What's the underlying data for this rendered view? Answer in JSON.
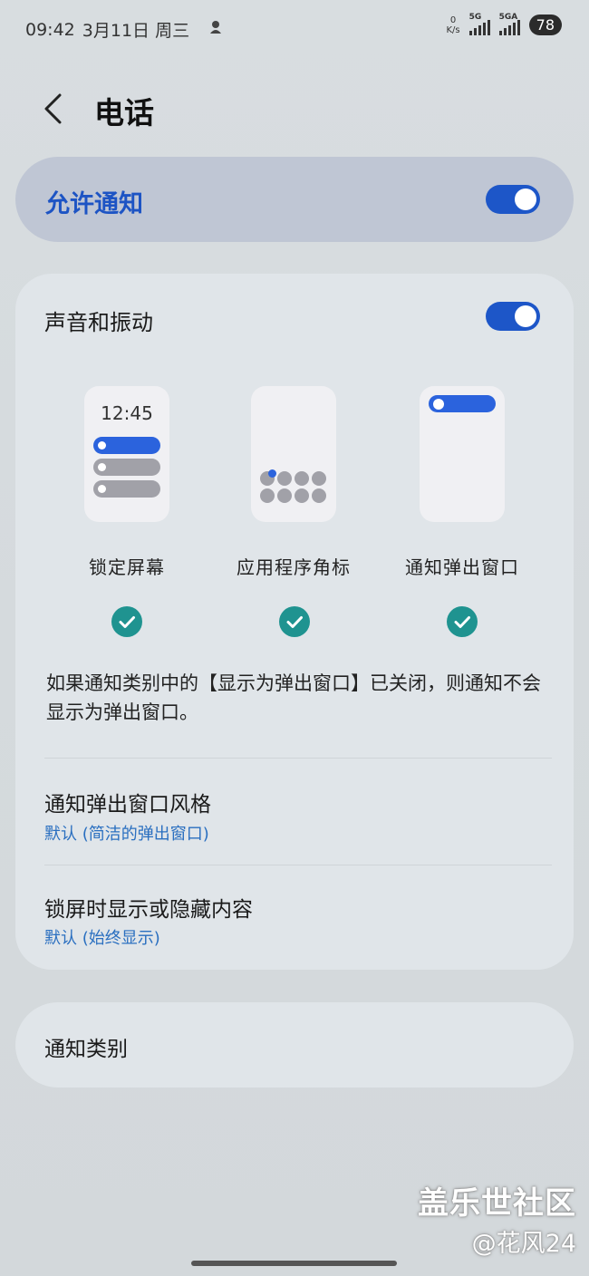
{
  "status_bar": {
    "time": "09:42",
    "date": "3月11日 周三",
    "net_speed_value": "0",
    "net_speed_unit": "K/s",
    "sim1_label": "5G",
    "sim2_label": "5GA",
    "battery": "78"
  },
  "header": {
    "title": "电话"
  },
  "allow_notifications": {
    "label": "允许通知",
    "enabled": true
  },
  "sound_vibration": {
    "label": "声音和振动",
    "enabled": true
  },
  "notification_types": {
    "lock_screen": {
      "label": "锁定屏幕",
      "preview_time": "12:45",
      "checked": true
    },
    "app_badge": {
      "label": "应用程序角标",
      "checked": true
    },
    "popup": {
      "label": "通知弹出窗口",
      "checked": true
    }
  },
  "info_text": "如果通知类别中的【显示为弹出窗口】已关闭，则通知不会显示为弹出窗口。",
  "popup_style": {
    "title": "通知弹出窗口风格",
    "value": "默认 (简洁的弹出窗口)"
  },
  "lockscreen_content": {
    "title": "锁屏时显示或隐藏内容",
    "value": "默认 (始终显示)"
  },
  "categories": {
    "label": "通知类别"
  },
  "watermark": {
    "site": "盖乐世社区",
    "author": "@花风24"
  },
  "colors": {
    "accent": "#1d56c8",
    "check": "#1f9390",
    "link": "#2a6fc0"
  }
}
